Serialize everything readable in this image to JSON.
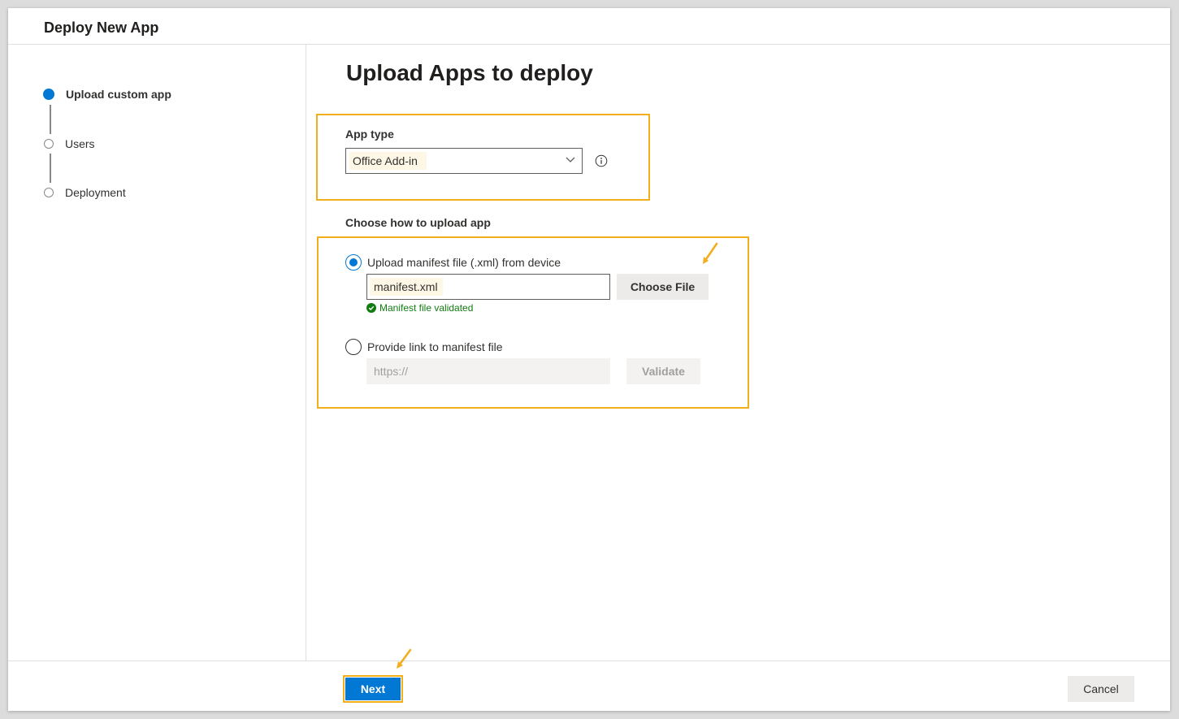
{
  "window": {
    "title": "Deploy New App"
  },
  "steps": [
    {
      "label": "Upload custom app",
      "active": true
    },
    {
      "label": "Users",
      "active": false
    },
    {
      "label": "Deployment",
      "active": false
    }
  ],
  "main": {
    "heading": "Upload Apps to deploy",
    "app_type": {
      "label": "App type",
      "selected": "Office Add-in"
    },
    "upload": {
      "label": "Choose how to upload app",
      "option_file": {
        "label": "Upload manifest file (.xml) from device",
        "checked": true,
        "file_value": "manifest.xml",
        "choose_button": "Choose File",
        "status": "Manifest file validated"
      },
      "option_link": {
        "label": "Provide link to manifest file",
        "checked": false,
        "placeholder": "https://",
        "validate_button": "Validate"
      }
    }
  },
  "footer": {
    "next_label": "Next",
    "cancel_label": "Cancel"
  },
  "colors": {
    "accent": "#0078d4",
    "highlight": "#f2ae1d",
    "success": "#107c10"
  }
}
